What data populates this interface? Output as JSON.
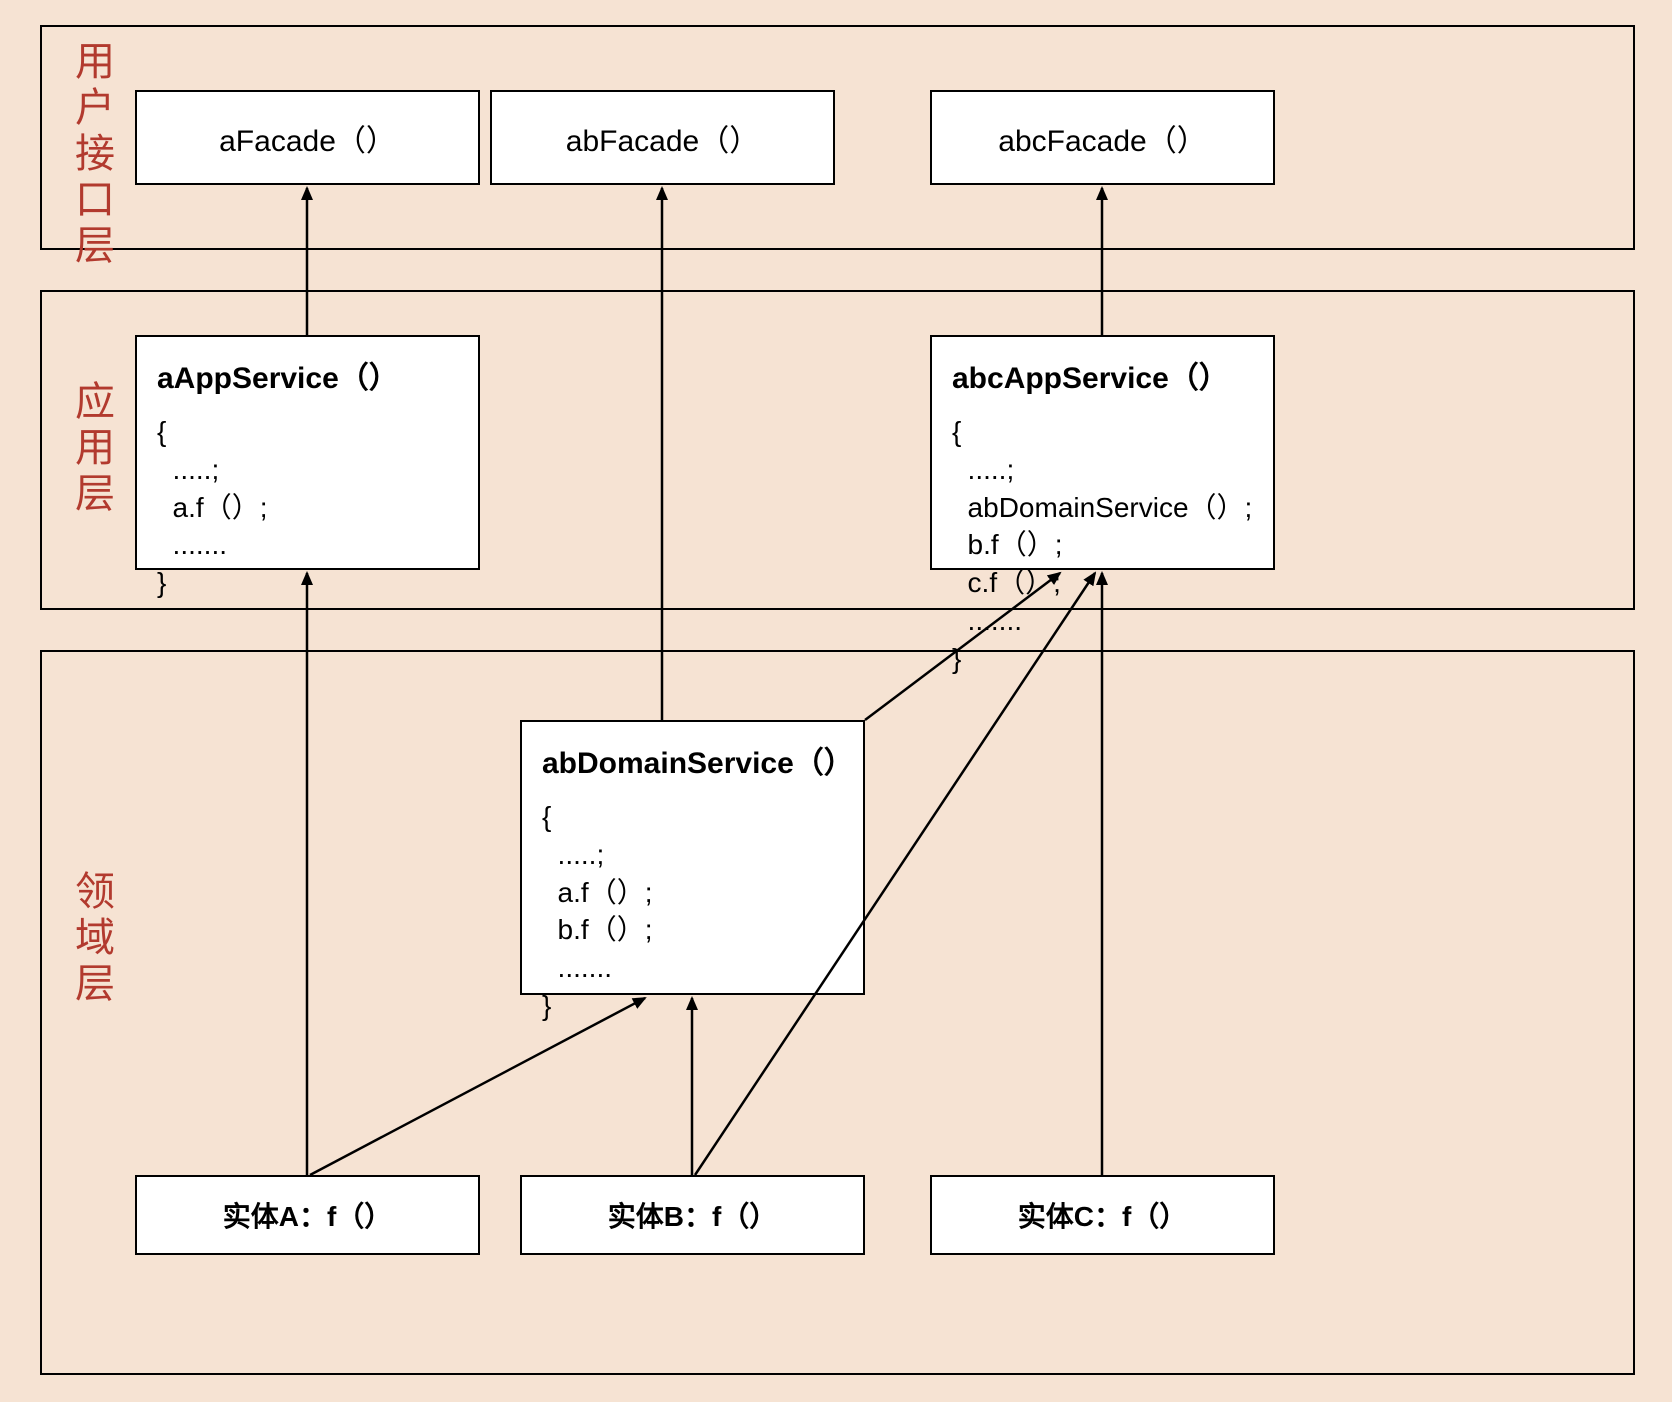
{
  "layers": {
    "ui": {
      "label": "用户接口层"
    },
    "app": {
      "label": "应用层"
    },
    "domain": {
      "label": "领域层"
    }
  },
  "facades": {
    "a": {
      "title": "aFacade（）"
    },
    "ab": {
      "title": "abFacade（）"
    },
    "abc": {
      "title": "abcFacade（）"
    }
  },
  "services": {
    "aApp": {
      "title": "aAppService（）",
      "body": "{\n  .....;\n  a.f（）;\n  .......\n}"
    },
    "abcApp": {
      "title": "abcAppService（）",
      "body": "{\n  .....;\n  abDomainService（）;\n  b.f（）;\n  c.f（）;\n  .......\n}"
    },
    "abDomain": {
      "title": "abDomainService（）",
      "body": "{\n  .....;\n  a.f（）;\n  b.f（）;\n  .......\n}"
    }
  },
  "entities": {
    "a": {
      "label": "实体A：f（）"
    },
    "b": {
      "label": "实体B：f（）"
    },
    "c": {
      "label": "实体C：f（）"
    }
  }
}
